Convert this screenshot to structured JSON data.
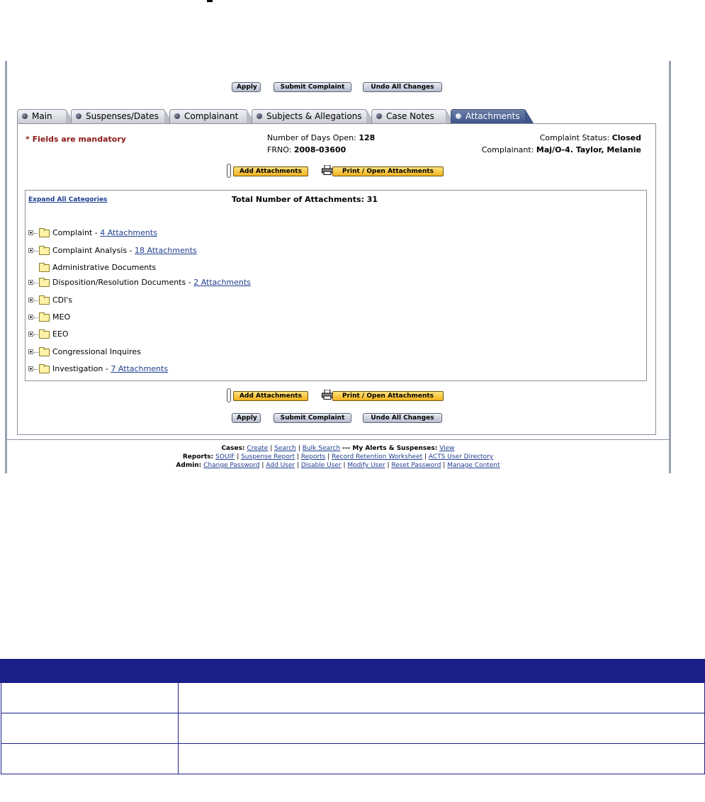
{
  "actions": {
    "apply": "Apply",
    "submit": "Submit Complaint",
    "undo": "Undo All Changes",
    "add_attachments": "Add Attachments",
    "print_open": "Print / Open Attachments"
  },
  "tabs": [
    {
      "label": "Main",
      "active": false
    },
    {
      "label": "Suspenses/Dates",
      "active": false
    },
    {
      "label": "Complainant",
      "active": false
    },
    {
      "label": "Subjects & Allegations",
      "active": false
    },
    {
      "label": "Case Notes",
      "active": false
    },
    {
      "label": "Attachments",
      "active": true
    }
  ],
  "header": {
    "mandatory": "* Fields are mandatory",
    "days_open_label": "Number of Days Open:",
    "days_open_value": "128",
    "frno_label": "FRNO:",
    "frno_value": "2008-03600",
    "status_label": "Complaint Status:",
    "status_value": "Closed",
    "complainant_label": "Complainant:",
    "complainant_value": "Maj/O-4. Taylor, Melanie"
  },
  "attachments": {
    "expand_all": "Expand All Categories",
    "total_label": "Total Number of Attachments:",
    "total_value": "31",
    "categories": [
      {
        "name": "Complaint",
        "sep": " - ",
        "link": "4 Attachments",
        "expandable": true
      },
      {
        "name": "Complaint Analysis",
        "sep": " - ",
        "link": "18 Attachments",
        "expandable": true
      },
      {
        "name": "Administrative Documents",
        "sep": "",
        "link": "",
        "expandable": false
      },
      {
        "name": "Disposition/Resolution Documents",
        "sep": " - ",
        "link": "2 Attachments",
        "expandable": true
      },
      {
        "name": "CDI's",
        "sep": "",
        "link": "",
        "expandable": true
      },
      {
        "name": "MEO",
        "sep": "",
        "link": "",
        "expandable": true
      },
      {
        "name": "EEO",
        "sep": "",
        "link": "",
        "expandable": true
      },
      {
        "name": "Congressional Inquires",
        "sep": "",
        "link": "",
        "expandable": true
      },
      {
        "name": "Investigation",
        "sep": " - ",
        "link": "7 Attachments",
        "expandable": true
      }
    ]
  },
  "footer": {
    "cases_label": "Cases:",
    "cases": [
      "Create",
      "Search",
      "Bulk Search"
    ],
    "alerts_label": "--- My Alerts & Suspenses:",
    "alerts_link": "View",
    "reports_label": "Reports:",
    "reports": [
      "SOUIF",
      "Suspense Report",
      "Reports",
      "Record Retention Worksheet",
      "ACTS User Directory"
    ],
    "admin_label": "Admin:",
    "admin": [
      "Change Password",
      "Add User",
      "Disable User",
      "Modify User",
      "Reset Password",
      "Manage Content"
    ]
  },
  "colors": {
    "tab_active": "#3d5588",
    "mandatory": "#8b1a1a",
    "table_header": "#1b1f8a",
    "gold_button": "#f2b21c"
  }
}
